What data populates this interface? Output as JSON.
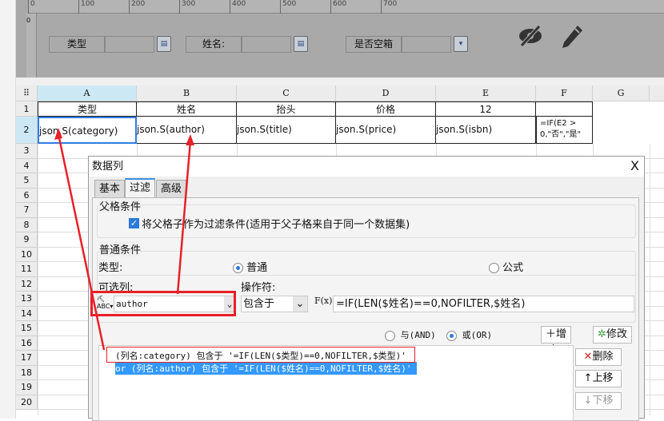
{
  "ruler": {
    "ticks": [
      "0",
      "100",
      "200",
      "300",
      "400",
      "500",
      "600",
      "700"
    ],
    "vtick": "0"
  },
  "params": [
    {
      "label": "类型"
    },
    {
      "label": "姓名:"
    },
    {
      "label": "是否空箱"
    }
  ],
  "toolbar_icons": [
    "eye-slash-icon",
    "pencil-icon"
  ],
  "columns": [
    "A",
    "B",
    "C",
    "D",
    "E",
    "F",
    "G"
  ],
  "rows": [
    "1",
    "2",
    "3",
    "4",
    "5",
    "6",
    "7",
    "8",
    "9",
    "10",
    "11",
    "12",
    "13",
    "14",
    "15",
    "16",
    "17",
    "18",
    "19",
    "20"
  ],
  "row1": [
    "类型",
    "姓名",
    "抬头",
    "价格",
    "12",
    ""
  ],
  "row2": [
    "json.S(category)",
    "json.S(author)",
    "json.S(title)",
    "json.S(price)",
    "json.S(isbn)",
    "=IF(E2 > 0,\"否\",\"是\""
  ],
  "dialog": {
    "title": "数据列",
    "close": "X",
    "tabs": [
      "基本",
      "过滤",
      "高级"
    ],
    "parent_group": "父格条件",
    "parent_checkbox": "将父格子作为过滤条件(适用于父子格来自于同一个数据集)",
    "normal_group": "普通条件",
    "type_label": "类型:",
    "type_normal": "普通",
    "type_formula": "公式",
    "column_label": "可选列:",
    "column_value": "author",
    "operator_label": "操作符:",
    "operator_value": "包含于",
    "formula_value": "=IF(LEN($姓名)==0,NOFILTER,$姓名)",
    "fx": "F(x)",
    "and_label": "与(AND)",
    "or_label": "或(OR)",
    "add": "增加",
    "modify": "修改",
    "delete": "删除",
    "up": "上移",
    "down": "下移",
    "conditions": [
      "(列名:category) 包含于 '=IF(LEN($类型)==0,NOFILTER,$类型)'",
      "or  (列名:author) 包含于 '=IF(LEN($姓名)==0,NOFILTER,$姓名)'"
    ]
  },
  "colors": {
    "annotation": "#e8202a",
    "selection": "#3399ff",
    "active_tab": "#3b8de0"
  }
}
